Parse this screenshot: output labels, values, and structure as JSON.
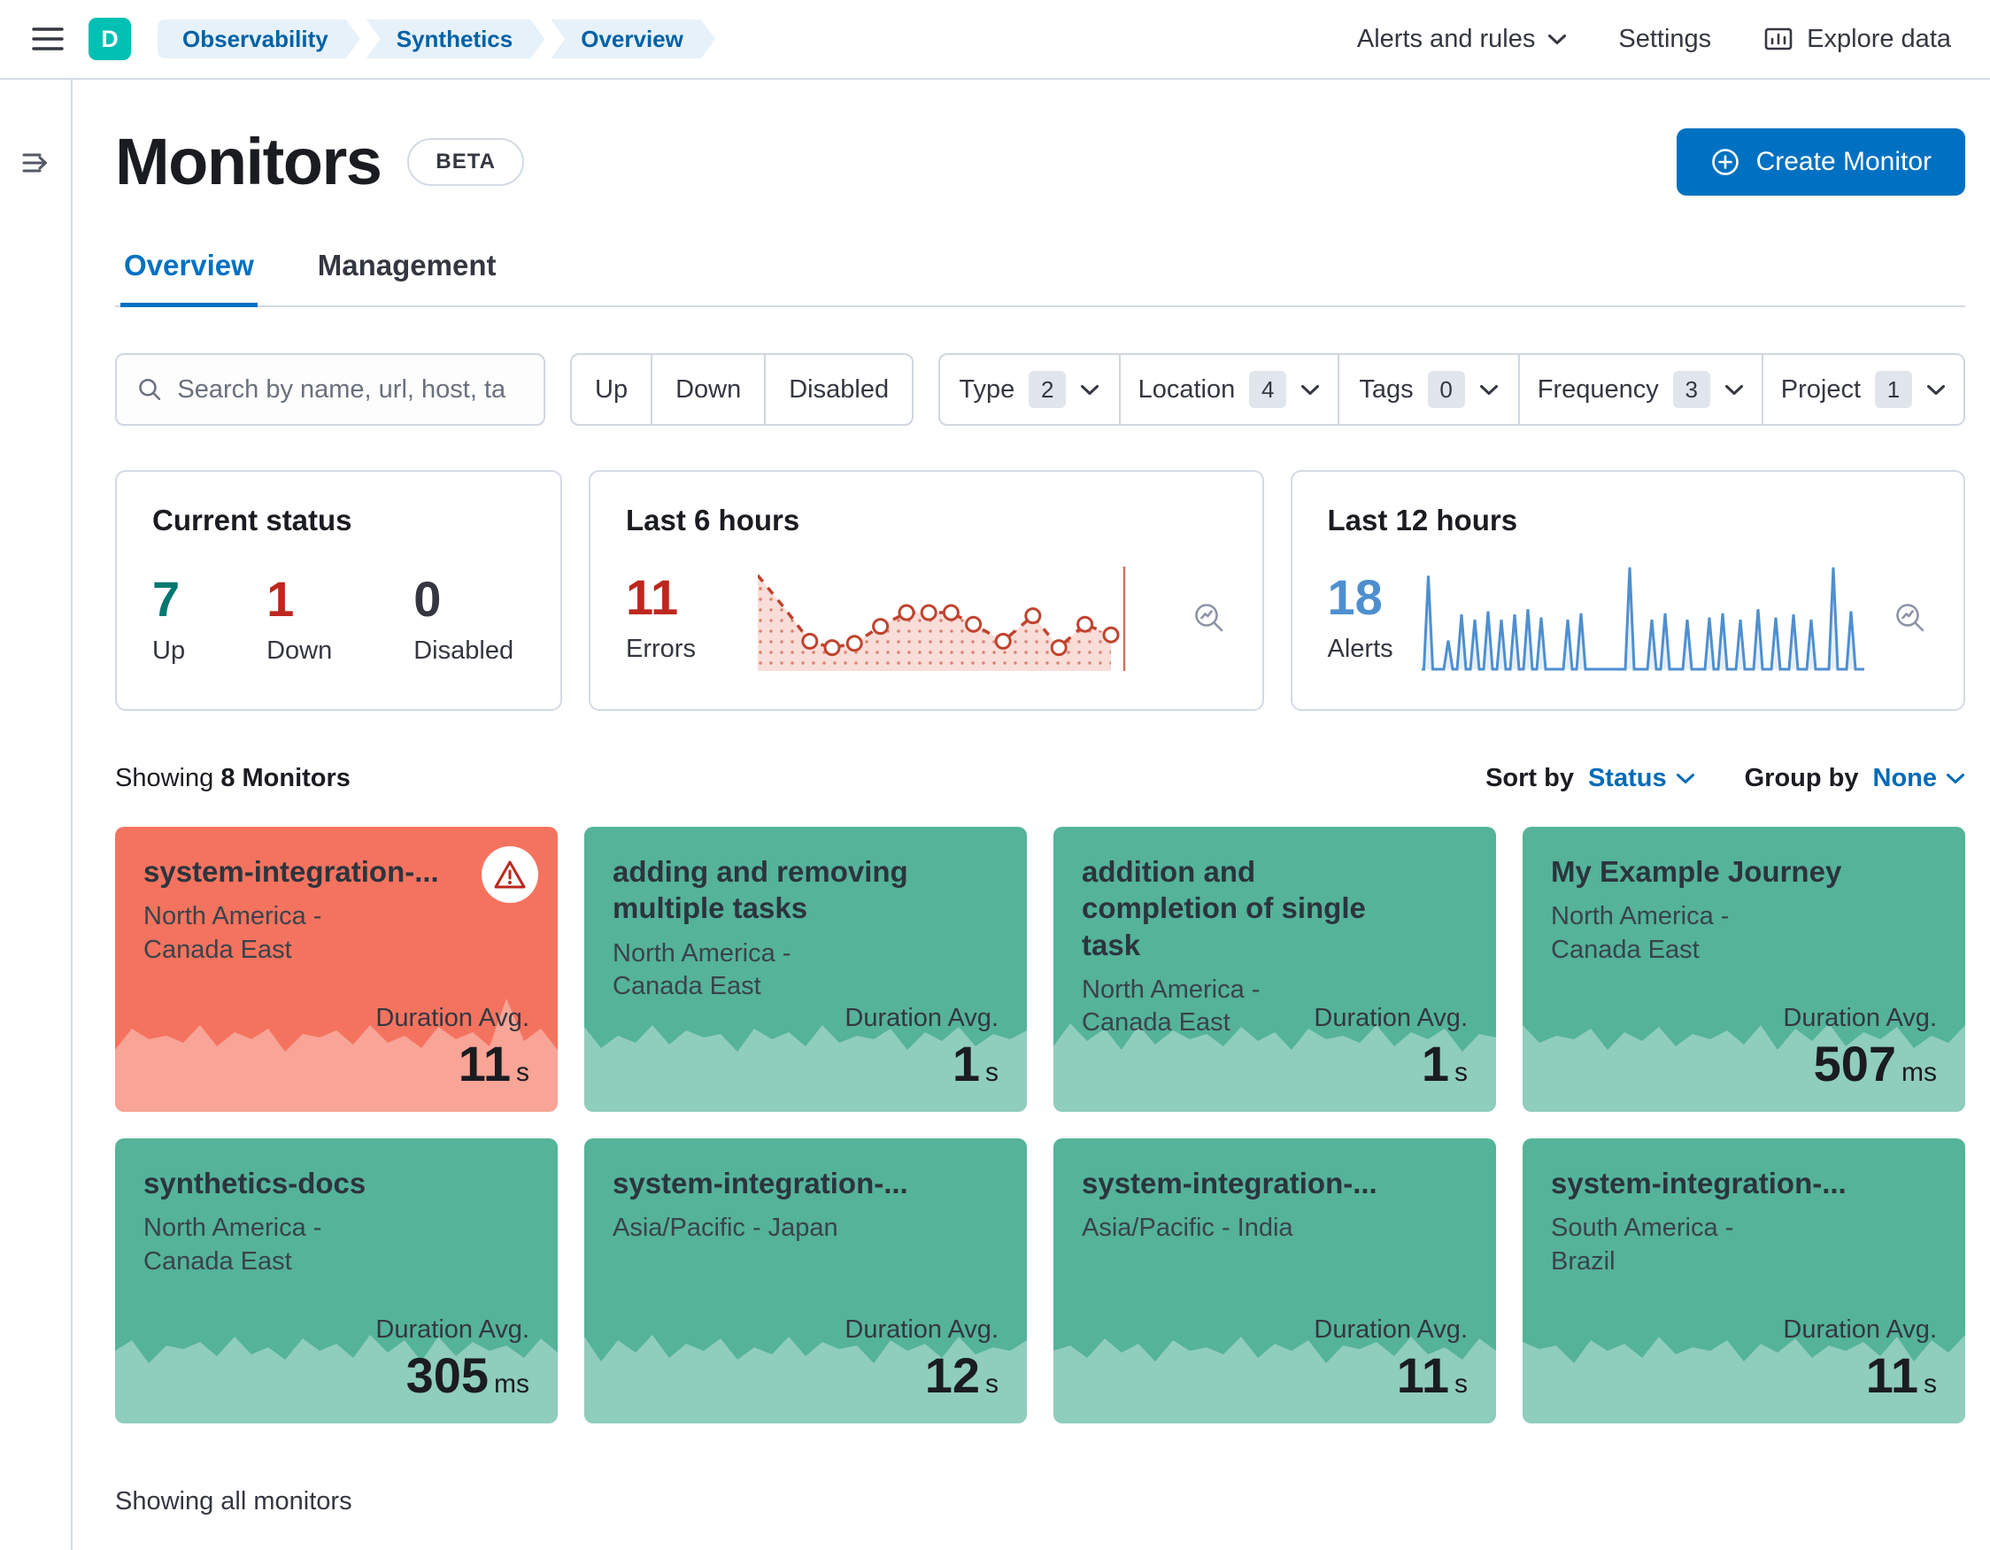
{
  "colors": {
    "primary": "#0071c2",
    "teal": "#00bfb3",
    "success_card": "#54b399",
    "danger_card": "#f4735f",
    "success_text": "#007871",
    "danger_text": "#bd271e",
    "alerts_blue": "#4e8fd0"
  },
  "labels": {
    "duration_avg": "Duration Avg."
  },
  "header": {
    "logo_letter": "D",
    "breadcrumbs": [
      {
        "label": "Observability"
      },
      {
        "label": "Synthetics"
      },
      {
        "label": "Overview"
      }
    ],
    "alerts_menu": "Alerts and rules",
    "settings": "Settings",
    "explore_data": "Explore data"
  },
  "page": {
    "title": "Monitors",
    "beta": "BETA",
    "create_button": "Create Monitor",
    "tabs": [
      {
        "label": "Overview",
        "active": true
      },
      {
        "label": "Management"
      }
    ],
    "search_placeholder": "Search by name, url, host, ta",
    "status_filters": [
      {
        "label": "Up"
      },
      {
        "label": "Down"
      },
      {
        "label": "Disabled"
      }
    ],
    "filters": [
      {
        "label": "Type",
        "count": "2"
      },
      {
        "label": "Location",
        "count": "4"
      },
      {
        "label": "Tags",
        "count": "0"
      },
      {
        "label": "Frequency",
        "count": "3"
      },
      {
        "label": "Project",
        "count": "1"
      }
    ]
  },
  "summary": {
    "current_status": {
      "title": "Current status",
      "up": {
        "value": "7",
        "label": "Up"
      },
      "down": {
        "value": "1",
        "label": "Down"
      },
      "disabled": {
        "value": "0",
        "label": "Disabled"
      }
    },
    "last6": {
      "title": "Last 6 hours",
      "value": "11",
      "label": "Errors",
      "chart": {
        "type": "line",
        "points": [
          {
            "x": 0.0,
            "y": 0.9
          },
          {
            "x": 0.07,
            "y": 0.6
          },
          {
            "x": 0.14,
            "y": 0.28,
            "m": 1
          },
          {
            "x": 0.2,
            "y": 0.22,
            "m": 1
          },
          {
            "x": 0.26,
            "y": 0.26,
            "m": 1
          },
          {
            "x": 0.33,
            "y": 0.42,
            "m": 1
          },
          {
            "x": 0.4,
            "y": 0.55,
            "m": 1
          },
          {
            "x": 0.46,
            "y": 0.55,
            "m": 1
          },
          {
            "x": 0.52,
            "y": 0.55,
            "m": 1
          },
          {
            "x": 0.58,
            "y": 0.44,
            "m": 1
          },
          {
            "x": 0.66,
            "y": 0.28,
            "m": 1
          },
          {
            "x": 0.74,
            "y": 0.52,
            "m": 1
          },
          {
            "x": 0.81,
            "y": 0.22,
            "m": 1
          },
          {
            "x": 0.88,
            "y": 0.44,
            "m": 1
          },
          {
            "x": 0.95,
            "y": 0.34,
            "m": 1
          }
        ]
      }
    },
    "last12": {
      "title": "Last 12 hours",
      "value": "18",
      "label": "Alerts",
      "chart": {
        "type": "spikes",
        "spikes": [
          {
            "x": 0.015,
            "h": 0.92
          },
          {
            "x": 0.06,
            "h": 0.3
          },
          {
            "x": 0.09,
            "h": 0.55
          },
          {
            "x": 0.12,
            "h": 0.5
          },
          {
            "x": 0.15,
            "h": 0.58
          },
          {
            "x": 0.18,
            "h": 0.5
          },
          {
            "x": 0.21,
            "h": 0.55
          },
          {
            "x": 0.24,
            "h": 0.6
          },
          {
            "x": 0.27,
            "h": 0.52
          },
          {
            "x": 0.33,
            "h": 0.5
          },
          {
            "x": 0.36,
            "h": 0.56
          },
          {
            "x": 0.47,
            "h": 1.0
          },
          {
            "x": 0.52,
            "h": 0.5
          },
          {
            "x": 0.55,
            "h": 0.56
          },
          {
            "x": 0.6,
            "h": 0.5
          },
          {
            "x": 0.65,
            "h": 0.52
          },
          {
            "x": 0.68,
            "h": 0.56
          },
          {
            "x": 0.72,
            "h": 0.5
          },
          {
            "x": 0.76,
            "h": 0.6
          },
          {
            "x": 0.8,
            "h": 0.52
          },
          {
            "x": 0.84,
            "h": 0.55
          },
          {
            "x": 0.88,
            "h": 0.5
          },
          {
            "x": 0.93,
            "h": 1.0
          },
          {
            "x": 0.97,
            "h": 0.58
          }
        ]
      }
    }
  },
  "toolbar": {
    "showing_prefix": "Showing",
    "showing_count": "8 Monitors",
    "sort_by_label": "Sort by",
    "sort_by_value": "Status",
    "group_by_label": "Group by",
    "group_by_value": "None"
  },
  "monitors": [
    {
      "name": "system-integration-...",
      "location": "North America - Canada East",
      "value": "11",
      "unit": "s",
      "status": "down"
    },
    {
      "name": "adding and removing multiple tasks",
      "location": "North America - Canada East",
      "value": "1",
      "unit": "s",
      "status": "up"
    },
    {
      "name": "addition and completion of single task",
      "location": "North America - Canada East",
      "value": "1",
      "unit": "s",
      "status": "up"
    },
    {
      "name": "My Example Journey",
      "location": "North America - Canada East",
      "value": "507",
      "unit": "ms",
      "status": "up"
    },
    {
      "name": "synthetics-docs",
      "location": "North America - Canada East",
      "value": "305",
      "unit": "ms",
      "status": "up"
    },
    {
      "name": "system-integration-...",
      "location": "Asia/Pacific - Japan",
      "value": "12",
      "unit": "s",
      "status": "up"
    },
    {
      "name": "system-integration-...",
      "location": "Asia/Pacific - India",
      "value": "11",
      "unit": "s",
      "status": "up"
    },
    {
      "name": "system-integration-...",
      "location": "South America - Brazil",
      "value": "11",
      "unit": "s",
      "status": "up"
    }
  ],
  "footer": {
    "note": "Showing all monitors"
  }
}
